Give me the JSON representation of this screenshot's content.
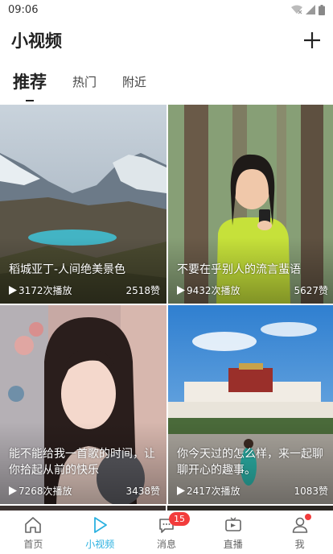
{
  "status_bar": {
    "time": "09:06"
  },
  "header": {
    "title": "小视频"
  },
  "tabs": [
    {
      "label": "推荐",
      "active": true
    },
    {
      "label": "热门",
      "active": false
    },
    {
      "label": "附近",
      "active": false
    }
  ],
  "videos": [
    {
      "title": "稻城亚丁-人间绝美景色",
      "plays": "3172次播放",
      "likes": "2518赞"
    },
    {
      "title": "不要在乎别人的流言蜚语",
      "plays": "9432次播放",
      "likes": "5627赞"
    },
    {
      "title": "能不能给我一首歌的时间，让你拾起从前的快乐",
      "plays": "7268次播放",
      "likes": "3438赞"
    },
    {
      "title": "你今天过的怎么样，来一起聊聊开心的趣事。",
      "plays": "2417次播放",
      "likes": "1083赞"
    }
  ],
  "bottom_nav": [
    {
      "label": "首页",
      "icon": "home-icon",
      "active": false
    },
    {
      "label": "小视频",
      "icon": "play-outline-icon",
      "active": true
    },
    {
      "label": "消息",
      "icon": "message-icon",
      "active": false,
      "badge": "15"
    },
    {
      "label": "直播",
      "icon": "live-camera-icon",
      "active": false
    },
    {
      "label": "我",
      "icon": "user-icon",
      "active": false,
      "dot": true
    }
  ],
  "colors": {
    "accent": "#2bb1e0",
    "badge": "#f23c3c"
  }
}
